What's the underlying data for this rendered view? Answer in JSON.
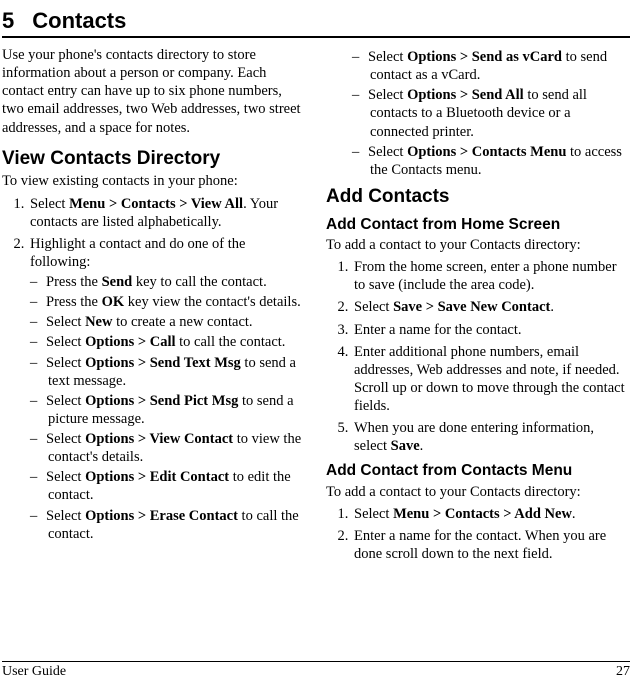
{
  "chapter": {
    "num": "5",
    "title": "Contacts"
  },
  "col1": {
    "intro": "Use your phone's contacts directory to store information about a person or company. Each contact entry can have up to six phone numbers, two email addresses, two Web addresses, two street addresses, and a space for notes.",
    "h1": "View Contacts Directory",
    "lead": "To view existing contacts in your phone:",
    "step1_pre": "Select ",
    "step1_bold": "Menu > Contacts > View All",
    "step1_post": ". Your contacts are listed alphabetically.",
    "step2": "Highlight a contact and do one of the following:",
    "sub1_pre": "Press the ",
    "sub1_bold": "Send",
    "sub1_post": " key to call the contact.",
    "sub2_pre": "Press the ",
    "sub2_bold": "OK",
    "sub2_post": " key view the contact's details.",
    "sub3_pre": "Select ",
    "sub3_bold": "New",
    "sub3_post": " to create a new contact.",
    "sub4_pre": "Select ",
    "sub4_bold": "Options > Call",
    "sub4_post": " to call the contact.",
    "sub5_pre": "Select ",
    "sub5_bold": "Options > Send Text Msg",
    "sub5_post": " to send a text message.",
    "sub6_pre": "Select ",
    "sub6_bold": "Options > Send Pict Msg",
    "sub6_post": " to send a picture message.",
    "sub7_pre": "Select ",
    "sub7_bold": "Options > View Contact",
    "sub7_post": " to view the contact's details.",
    "sub8_pre": "Select ",
    "sub8_bold": "Options > Edit Contact",
    "sub8_post": " to edit the contact.",
    "sub9_pre": "Select ",
    "sub9_bold": "Options > Erase Contact",
    "sub9_post": " to call the contact."
  },
  "col2": {
    "sub10_pre": "Select ",
    "sub10_bold": "Options > Send as vCard",
    "sub10_post": " to send contact as a vCard.",
    "sub11_pre": "Select ",
    "sub11_bold": "Options > Send All",
    "sub11_post": " to send all contacts to a Bluetooth device or a connected printer.",
    "sub12_pre": "Select ",
    "sub12_bold": "Options > Contacts Menu",
    "sub12_post": " to access the Contacts menu.",
    "h1": "Add Contacts",
    "h2a": "Add Contact from Home Screen",
    "leada": "To add a contact to your Contacts directory:",
    "a1": "From the home screen, enter a phone number to save (include the area code).",
    "a2_pre": "Select ",
    "a2_bold": "Save > Save New Contact",
    "a2_post": ".",
    "a3": "Enter a name for the contact.",
    "a4": "Enter additional phone numbers, email addresses, Web addresses and note, if needed. Scroll up or down to move through the contact fields.",
    "a5_pre": "When you are done entering information, select ",
    "a5_bold": "Save",
    "a5_post": ".",
    "h2b": "Add Contact from Contacts Menu",
    "leadb": "To add a contact to your Contacts directory:",
    "b1_pre": "Select ",
    "b1_bold": "Menu > Contacts > Add New",
    "b1_post": ".",
    "b2": "Enter a name for the contact. When you are done scroll down to the next field."
  },
  "footer": {
    "left": "User Guide",
    "right": "27"
  }
}
